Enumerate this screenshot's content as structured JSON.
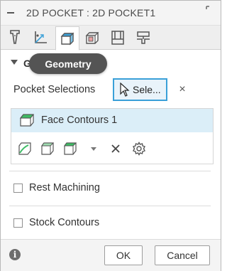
{
  "dialog": {
    "title": "2D POCKET : 2D POCKET1"
  },
  "tabs": [
    {
      "icon": "tool-icon"
    },
    {
      "icon": "coordinate-axes-icon"
    },
    {
      "icon": "geometry-icon",
      "active": true
    },
    {
      "icon": "heights-icon"
    },
    {
      "icon": "passes-icon"
    },
    {
      "icon": "linking-icon"
    }
  ],
  "section": {
    "title_partial": "G",
    "tooltip": "Geometry"
  },
  "pocket_selections": {
    "label": "Pocket Selections",
    "select_label": "Sele...",
    "clear_symbol": "×",
    "items": [
      {
        "label": "Face Contours 1"
      }
    ],
    "tool_icons": [
      "chain-select-icon",
      "face-select-icon",
      "face-alt-select-icon",
      "dropdown-arrow-icon",
      "remove-icon",
      "settings-icon"
    ]
  },
  "options": {
    "rest_machining": {
      "label": "Rest Machining",
      "checked": false
    },
    "stock_contours": {
      "label": "Stock Contours",
      "checked": false
    }
  },
  "footer": {
    "info_symbol": "i",
    "ok_label": "OK",
    "cancel_label": "Cancel"
  },
  "colors": {
    "accent": "#3aa0d8",
    "selection_bg": "#dbeef8",
    "face_green": "#3dbb64",
    "tooltip_bg": "#545454"
  }
}
